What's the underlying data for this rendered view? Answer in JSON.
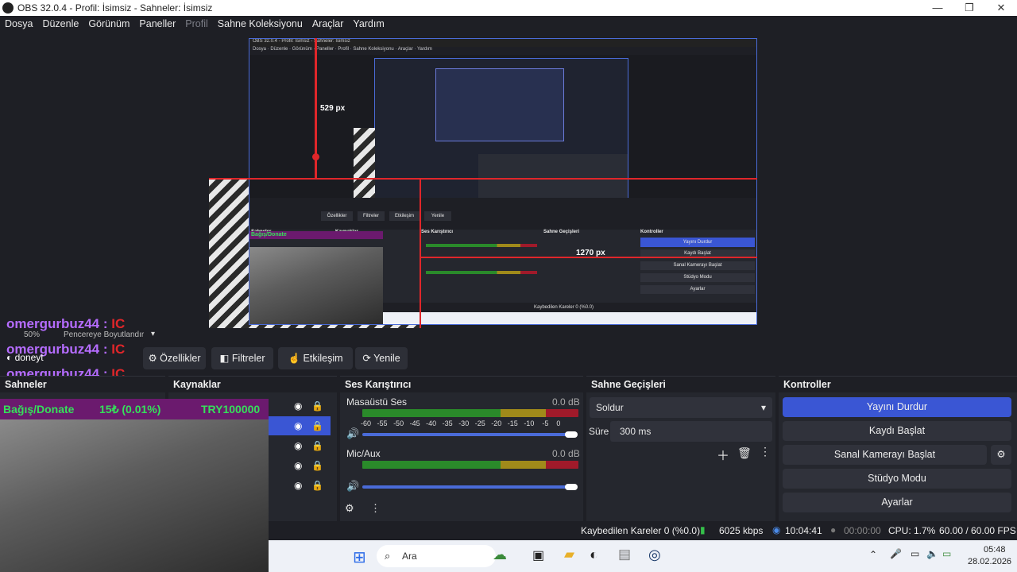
{
  "window": {
    "title": "OBS 32.0.4 - Profil: İsimsiz - Sahneler: İsimsiz",
    "minimize": "—",
    "maximize": "❐",
    "close": "✕"
  },
  "menu": [
    "Dosya",
    "Düzenle",
    "Görünüm",
    "Paneller",
    "Profil",
    "Sahne Koleksiyonu",
    "Araçlar",
    "Yardım"
  ],
  "preview": {
    "measure_v": "529 px",
    "measure_h": "1270 px",
    "inner_title": "OBS 32.0.4 - Profil: İsimsiz - Sahneler: İsimsiz"
  },
  "zoom": {
    "value": "50%",
    "mode": "Pencereye Boyutlandır"
  },
  "overlay": {
    "user": "omergurbuz44",
    "user_suffix": "IC",
    "donate_label": "Bağış/Donate",
    "donate_value": "15₺ (0.01%)",
    "donate_goal": "TRY100000",
    "source_name": "doneyt"
  },
  "toolbar": {
    "properties": "Özellikler",
    "filters": "Filtreler",
    "interact": "Etkileşim",
    "refresh": "Yenile"
  },
  "docks": {
    "scenes": "Sahneler",
    "sources": "Kaynaklar",
    "mixer": "Ses Karıştırıcı",
    "transitions": "Sahne Geçişleri",
    "controls": "Kontroller"
  },
  "mixer": {
    "channels": [
      {
        "name": "Masaüstü Ses",
        "db": "0.0 dB"
      },
      {
        "name": "Mic/Aux",
        "db": "0.0 dB"
      }
    ],
    "ticks": [
      "-60",
      "-55",
      "-50",
      "-45",
      "-40",
      "-35",
      "-30",
      "-25",
      "-20",
      "-15",
      "-10",
      "-5",
      "0"
    ]
  },
  "transitions": {
    "selected": "Soldur",
    "duration_label": "Süre",
    "duration": "300 ms"
  },
  "controls": {
    "stream": "Yayını Durdur",
    "record": "Kaydı Başlat",
    "virtualcam": "Sanal Kamerayı Başlat",
    "studio": "Stüdyo Modu",
    "settings": "Ayarlar"
  },
  "status": {
    "dropped": "Kaybedilen Kareler 0 (%0.0)",
    "bitrate": "6025 kbps",
    "stream_time": "10:04:41",
    "rec_time": "00:00:00",
    "cpu": "CPU: 1.7%",
    "fps": "60.00 / 60.00 FPS"
  },
  "taskbar": {
    "search": "Ara",
    "time": "05:48",
    "date": "28.02.2026"
  },
  "colors": {
    "accent": "#3a56d4",
    "bg": "#1e1f25",
    "panel": "#25272e",
    "red": "#e0262a",
    "chat": "#b56cff",
    "donate_bg": "#6b1a6e",
    "donate_text": "#35e05a"
  }
}
